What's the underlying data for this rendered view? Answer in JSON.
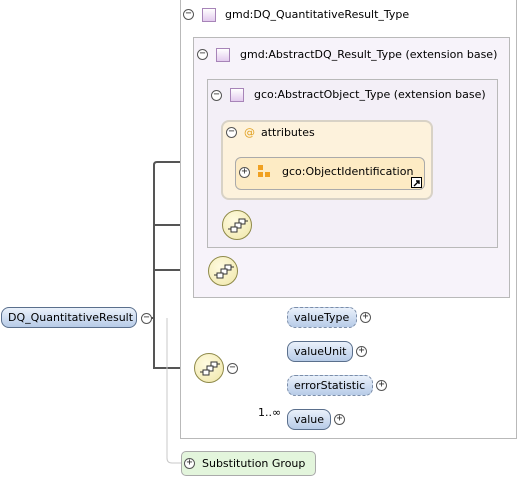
{
  "root_element": "DQ_QuantitativeResult",
  "outer_type": "gmd:DQ_QuantitativeResult_Type",
  "base_type": "gmd:AbstractDQ_Result_Type (extension base)",
  "object_type": "gco:AbstractObject_Type (extension base)",
  "attributes_label": "attributes",
  "attributes_symbol": "@",
  "attribute_group": "gco:ObjectIdentification",
  "children": [
    {
      "label": "valueType",
      "optional": true
    },
    {
      "label": "valueUnit",
      "optional": false
    },
    {
      "label": "errorStatistic",
      "optional": true
    },
    {
      "label": "value",
      "optional": false
    }
  ],
  "value_cardinality": "1..∞",
  "substitution_group": "Substitution Group",
  "toggle_collapse": "−",
  "toggle_expand": "+",
  "colors": {
    "element_fill": "#b7cbe7",
    "type_box_fill": "#f7f3fa",
    "attributes_fill": "#fdf2dc",
    "substitution_fill": "#e3f5dc"
  }
}
